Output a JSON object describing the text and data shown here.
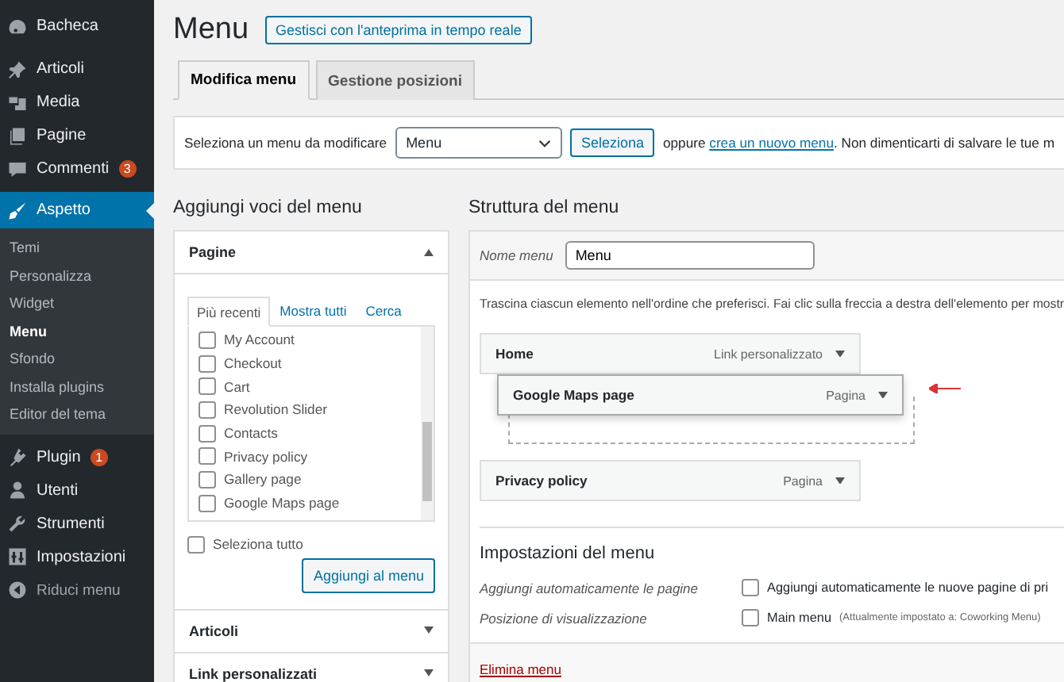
{
  "sidebar": {
    "items": [
      {
        "label": "Bacheca",
        "selected": false
      },
      {
        "label": "Articoli",
        "selected": false
      },
      {
        "label": "Media",
        "selected": false
      },
      {
        "label": "Pagine",
        "selected": false
      },
      {
        "label": "Commenti",
        "selected": false,
        "badge": "3"
      },
      {
        "label": "Aspetto",
        "selected": true,
        "children": [
          {
            "label": "Temi",
            "selected": false
          },
          {
            "label": "Personalizza",
            "selected": false
          },
          {
            "label": "Widget",
            "selected": false
          },
          {
            "label": "Menu",
            "selected": true
          },
          {
            "label": "Sfondo",
            "selected": false
          },
          {
            "label": "Installa plugins",
            "selected": false
          },
          {
            "label": "Editor del tema",
            "selected": false
          }
        ]
      },
      {
        "label": "Plugin",
        "selected": false,
        "badge": "1"
      },
      {
        "label": "Utenti",
        "selected": false
      },
      {
        "label": "Strumenti",
        "selected": false
      },
      {
        "label": "Impostazioni",
        "selected": false
      }
    ],
    "collapse": "Riduci menu"
  },
  "page": {
    "title": "Menu",
    "live_preview_button": "Gestisci con l'anteprima in tempo reale"
  },
  "tabs": [
    {
      "label": "Modifica menu",
      "selected": true
    },
    {
      "label": "Gestione posizioni",
      "selected": false
    }
  ],
  "menu_select": {
    "label": "Seleziona un menu da modificare",
    "value": "Menu",
    "button": "Seleziona",
    "text_before": "oppure",
    "link": "crea un nuovo menu",
    "text_after": ". Non dimenticarti di salvare le tue m"
  },
  "add_items": {
    "title": "Aggiungi voci del menu",
    "sections": [
      {
        "title": "Pagine",
        "expanded": true,
        "tabs": [
          {
            "label": "Più recenti",
            "selected": true
          },
          {
            "label": "Mostra tutti",
            "selected": false
          },
          {
            "label": "Cerca",
            "selected": false
          }
        ],
        "pages": [
          {
            "label": "My Account",
            "checked": false
          },
          {
            "label": "Checkout",
            "checked": false
          },
          {
            "label": "Cart",
            "checked": false
          },
          {
            "label": "Revolution Slider",
            "checked": false
          },
          {
            "label": "Contacts",
            "checked": false
          },
          {
            "label": "Privacy policy",
            "checked": false
          },
          {
            "label": "Gallery page",
            "checked": false
          },
          {
            "label": "Google Maps page",
            "checked": false
          }
        ],
        "select_all": {
          "label": "Seleziona tutto",
          "checked": false
        },
        "button": "Aggiungi al menu"
      },
      {
        "title": "Articoli",
        "expanded": false
      },
      {
        "title": "Link personalizzati",
        "expanded": false
      }
    ]
  },
  "structure": {
    "title": "Struttura del menu",
    "name_label": "Nome menu",
    "name_value": "Menu",
    "instructions": "Trascina ciascun elemento nell'ordine che preferisci. Fai clic sulla freccia a destra dell'elemento per mostr",
    "items": [
      {
        "label": "Home",
        "type": "Link personalizzato",
        "dragging": false
      },
      {
        "label": "Google Maps page",
        "type": "Pagina",
        "dragging": true
      },
      {
        "label": "Privacy policy",
        "type": "Pagina",
        "dragging": false
      }
    ],
    "settings": {
      "title": "Impostazioni del menu",
      "rows": [
        {
          "label": "Aggiungi automaticamente le pagine",
          "option": "Aggiungi automaticamente le nuove pagine di pri",
          "checked": false
        },
        {
          "label": "Posizione di visualizzazione",
          "option": "Main menu",
          "note": "(Attualmente impostato a: Coworking Menu)",
          "checked": false
        }
      ]
    },
    "delete_link": "Elimina menu"
  }
}
